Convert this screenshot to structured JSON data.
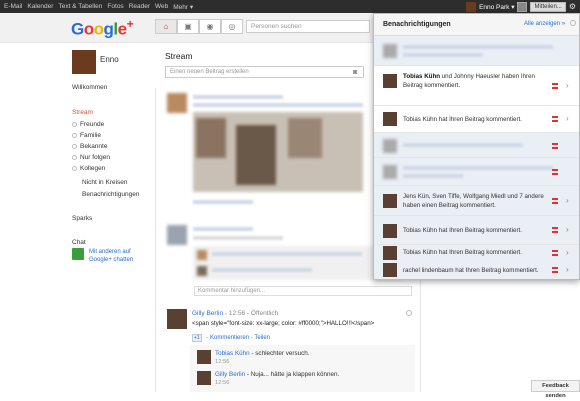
{
  "topbar": {
    "links": [
      "E-Mail",
      "Kalender",
      "Text & Tabellen",
      "Fotos",
      "Reader",
      "Web",
      "Mehr ▾"
    ],
    "user": "Enno Park ▾",
    "notif_count": "",
    "share": "Mitteilen...",
    "gear": "⚙"
  },
  "header": {
    "logo_text": "Google",
    "logo_plus": "+",
    "search_placeholder": "Personen suchen"
  },
  "profile": {
    "name": "Enno"
  },
  "sidebar": {
    "willkommen": "Willkommen",
    "stream": "Stream",
    "circles": [
      "Freunde",
      "Familie",
      "Bekannte",
      "Nur folgen",
      "Kollegen"
    ],
    "nicht_in_kreisen": "Nicht in Kreisen",
    "benachrichtigungen": "Benachrichtigungen",
    "sparks": "Sparks",
    "chat": "Chat",
    "chat_link": "Mit anderen auf Google+ chatten"
  },
  "stream": {
    "title": "Stream",
    "post_placeholder": "Einen neuen Beitrag erstellen",
    "comment_placeholder": "Kommentar hinzufügen..."
  },
  "post": {
    "author": "Gilly Berlin",
    "separator": " - ",
    "time": "12:56",
    "visibility": "Öffentlich",
    "content": "<span style=\"font-size: xx-large; color: #ff0000;\">HALLO!!!</span>",
    "plus": "+1",
    "action_comment": "Kommentieren",
    "action_share": "Teilen",
    "comments": [
      {
        "author": "Tobias Kühn",
        "text": " - schlechter versuch.",
        "time": "12:56"
      },
      {
        "author": "Gilly Berlin",
        "text": " - Nuja... hätte ja klappen können.",
        "time": "12:56"
      }
    ]
  },
  "notifications": {
    "title": "Benachrichtigungen",
    "all_link": "Alle anzeigen »",
    "items": [
      {
        "text_bold": "Tobias Kühn",
        "text": " und Johnny Haeusler haben Ihren Beitrag kommentiert."
      },
      {
        "text_bold": "",
        "text": "Tobias Kühn hat Ihren Beitrag kommentiert."
      },
      {
        "text_bold": "",
        "text": "Jens Kün, Sven Tiffe, Wolfgang Miedl und 7 andere haben einen Beitrag kommentiert."
      },
      {
        "text_bold": "",
        "text": "Tobias Kühn hat Ihren Beitrag kommentiert."
      },
      {
        "text_bold": "",
        "text": "Tobias Kühn hat Ihren Beitrag kommentiert."
      },
      {
        "text_bold": "",
        "text": "rachel lindenbaum hat Ihren Beitrag kommentiert."
      }
    ]
  },
  "feedback": "Feedback senden"
}
